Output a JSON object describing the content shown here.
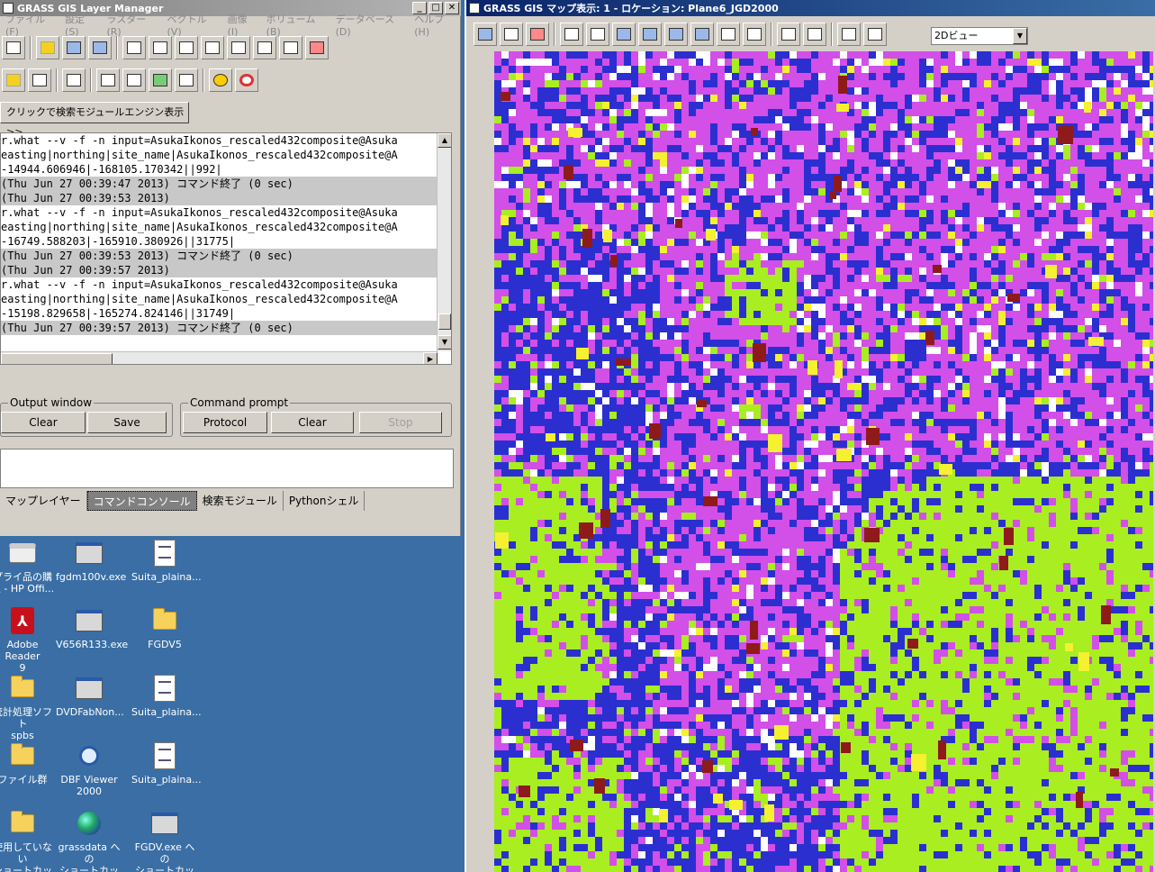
{
  "layer_manager": {
    "title": "GRASS GIS Layer Manager",
    "menu": [
      "ファイル(F)",
      "設定(S)",
      "ラスター(R)",
      "ベクトル(V)",
      "画像(I)",
      "ボリューム(B)",
      "データベース(D)",
      "ヘルプ(H)"
    ],
    "search_button": "クリックで検索モジュールエンジン表示 >>",
    "console_lines": [
      {
        "text": "r.what --v -f -n input=AsukaIkonos_rescaled432composite@Asuka",
        "grey": false
      },
      {
        "text": "easting|northing|site_name|AsukaIkonos_rescaled432composite@A",
        "grey": false
      },
      {
        "text": "-14944.606946|-168105.170342||992|",
        "grey": false
      },
      {
        "text": "(Thu Jun 27 00:39:47 2013) コマンド終了 (0 sec)",
        "grey": true
      },
      {
        "text": "(Thu Jun 27 00:39:53 2013)",
        "grey": true
      },
      {
        "text": "r.what --v -f -n input=AsukaIkonos_rescaled432composite@Asuka",
        "grey": false
      },
      {
        "text": "easting|northing|site_name|AsukaIkonos_rescaled432composite@A",
        "grey": false
      },
      {
        "text": "-16749.588203|-165910.380926||31775|",
        "grey": false
      },
      {
        "text": "(Thu Jun 27 00:39:53 2013) コマンド終了 (0 sec)",
        "grey": true
      },
      {
        "text": "(Thu Jun 27 00:39:57 2013)",
        "grey": true
      },
      {
        "text": "r.what --v -f -n input=AsukaIkonos_rescaled432composite@Asuka",
        "grey": false
      },
      {
        "text": "easting|northing|site_name|AsukaIkonos_rescaled432composite@A",
        "grey": false
      },
      {
        "text": "-15198.829658|-165274.824146||31749|",
        "grey": false
      },
      {
        "text": "(Thu Jun 27 00:39:57 2013) コマンド終了 (0 sec)",
        "grey": true
      }
    ],
    "output_window": {
      "label": "Output window",
      "clear": "Clear",
      "save": "Save"
    },
    "command_prompt": {
      "label": "Command prompt",
      "protocol": "Protocol",
      "clear": "Clear",
      "stop": "Stop"
    },
    "tabs": [
      "マップレイヤー",
      "コマンドコンソール",
      "検索モジュール",
      "Pythonシェル"
    ]
  },
  "map_display": {
    "title": "GRASS GIS マップ表示: 1 - ロケーション: Plane6_JGD2000",
    "view_mode": "2Dビュー",
    "colors": {
      "magenta": "#d24fe8",
      "blue": "#2b2fd0",
      "lime": "#a8ee20",
      "yellow": "#f5f030",
      "red": "#8e1a1a",
      "white": "#ffffff"
    }
  },
  "desktop": {
    "icons": [
      {
        "label": "プライ品の購\n入 - HP Offi...",
        "kind": "printer"
      },
      {
        "label": "fgdm100v.exe",
        "kind": "exe"
      },
      {
        "label": "Suita_plaina...",
        "kind": "doc"
      },
      {
        "label": "Adobe Reader\n9",
        "kind": "pdf"
      },
      {
        "label": "V656R133.exe",
        "kind": "exe"
      },
      {
        "label": "FGDV5",
        "kind": "folder"
      },
      {
        "label": "統計処理ソフト\nspbs",
        "kind": "folder"
      },
      {
        "label": "DVDFabNon...",
        "kind": "exe"
      },
      {
        "label": "Suita_plaina...",
        "kind": "doc"
      },
      {
        "label": "ファイル群",
        "kind": "folder"
      },
      {
        "label": "DBF Viewer\n2000",
        "kind": "mag"
      },
      {
        "label": "Suita_plaina...",
        "kind": "doc"
      },
      {
        "label": "使用していない\nショートカット",
        "kind": "folder"
      },
      {
        "label": "grassdata への\nショートカット",
        "kind": "globe"
      },
      {
        "label": "FGDV.exe への\nショートカット",
        "kind": "exe"
      }
    ]
  }
}
